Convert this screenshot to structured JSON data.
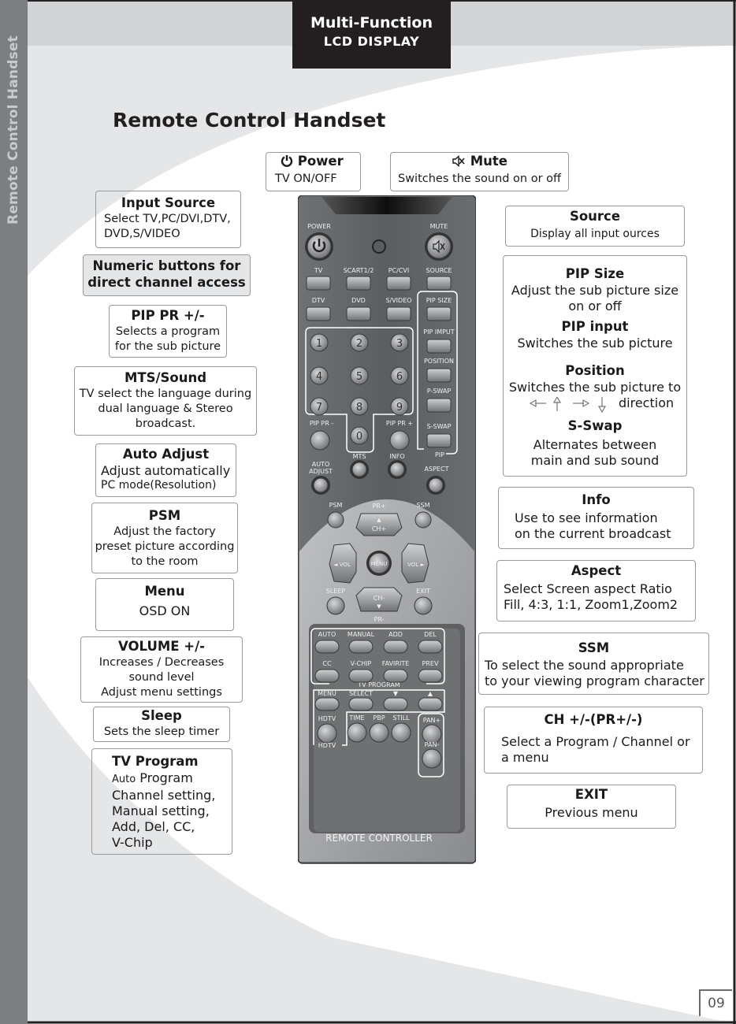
{
  "header": {
    "line1": "Multi-Function",
    "line2": "LCD DISPLAY"
  },
  "side_label": "Remote Control Handset",
  "page_title": "Remote Control Handset",
  "page_number": "09",
  "callouts": {
    "power": {
      "title": "Power",
      "desc": "TV  ON/OFF",
      "icon": "power-icon"
    },
    "mute": {
      "title": "Mute",
      "desc": "Switches the sound on or off",
      "icon": "speaker-mute-icon"
    },
    "input_source": {
      "title": "Input  Source",
      "desc": "Select  TV,PC/DVI,DTV,\nDVD,S/VIDEO"
    },
    "numeric": {
      "title": "Numeric buttons for\ndirect channel access"
    },
    "pip_pr": {
      "title": "PIP PR +/-",
      "desc": "Selects a program\nfor the sub picture"
    },
    "mts": {
      "title": "MTS/Sound",
      "desc": "TV select the language during\ndual language & Stereo\nbroadcast."
    },
    "auto_adjust": {
      "title": "Auto Adjust",
      "desc1": "Adjust automatically",
      "desc2": "PC mode(Resolution)"
    },
    "psm": {
      "title": "PSM",
      "desc": "Adjust the factory\npreset picture according\nto the room"
    },
    "menu": {
      "title": "Menu",
      "desc": "OSD ON"
    },
    "volume": {
      "title": "VOLUME +/-",
      "desc": "Increases / Decreases\nsound level\nAdjust menu settings"
    },
    "sleep": {
      "title": "Sleep",
      "desc": "Sets the sleep timer"
    },
    "tv_program": {
      "title": "TV Program",
      "desc_small": "Auto",
      "desc": "Program\nChannel setting,\nManual setting,\nAdd, Del, CC,\nV-Chip"
    },
    "source": {
      "title": "Source",
      "desc": "Display all input ources"
    },
    "pip_size": {
      "title": "PIP Size",
      "desc": "Adjust  the sub picture size\non or off"
    },
    "pip_input": {
      "title": "PIP input",
      "desc": "Switches the sub picture"
    },
    "position": {
      "title": "Position",
      "desc": "Switches the sub picture to",
      "desc2": "direction",
      "arrows": [
        "left-arrow-icon",
        "up-arrow-icon",
        "right-arrow-icon",
        "down-arrow-icon"
      ]
    },
    "s_swap": {
      "title": "S-Swap",
      "desc": "Alternates between\nmain and sub sound"
    },
    "info": {
      "title": "Info",
      "desc": "Use to see information\non the current broadcast"
    },
    "aspect": {
      "title": "Aspect",
      "desc": "Select Screen aspect Ratio\n Fill, 4:3, 1:1, Zoom1,Zoom2"
    },
    "ssm": {
      "title": "SSM",
      "desc": "To select the sound appropriate\nto your viewing program character"
    },
    "ch": {
      "title": "CH +/-(PR+/-)",
      "desc": "Select a Program / Channel or\na menu"
    },
    "exit": {
      "title": "EXIT",
      "desc": "Previous menu"
    }
  },
  "remote": {
    "power": "POWER",
    "mute": "MUTE",
    "row1": [
      "TV",
      "SCART1/2",
      "PC/CVI",
      "SOURCE"
    ],
    "row2": [
      "DTV",
      "DVD",
      "S/VIDEO",
      "PIP SIZE"
    ],
    "pip_column": [
      "PIP IMPUT",
      "POSITION",
      "P-SWAP",
      "S-SWAP"
    ],
    "pip_group": "PIP",
    "digits": [
      "1",
      "2",
      "3",
      "4",
      "5",
      "6",
      "7",
      "8",
      "9",
      "0"
    ],
    "pip_pr_minus": "PIP PR -",
    "pip_pr_plus": "PIP PR +",
    "auto_adjust": [
      "AUTO",
      "ADJUST"
    ],
    "mts": "MTS",
    "info": "INFO",
    "aspect": "ASPECT",
    "psm": "PSM",
    "ssm": "SSM",
    "pr_plus": "PR+",
    "ch_plus": "CH+",
    "vol_left": "◄ VOL",
    "menu": "MENU",
    "vol_right": "VOL ►",
    "sleep": "SLEEP",
    "exit": "EXIT",
    "ch_minus": "CH-",
    "pr_minus": "PR-",
    "tvp_row1": [
      "AUTO",
      "MANUAL",
      "ADD",
      "DEL"
    ],
    "tvp_row2": [
      "CC",
      "V-CHIP",
      "FAVIRITE",
      "PREV"
    ],
    "tv_program": "TV PROGRAM",
    "nav_row": [
      "MENU",
      "SELECT",
      "▼",
      "▲"
    ],
    "hdtv": "HDTV",
    "hdtv_group": "HDTV",
    "bottom_row": [
      "TIME",
      "PBP",
      "STILL"
    ],
    "pan_plus": "PAN+",
    "pan_minus": "PAN-",
    "brand": "REMOTE CONTROLLER"
  }
}
